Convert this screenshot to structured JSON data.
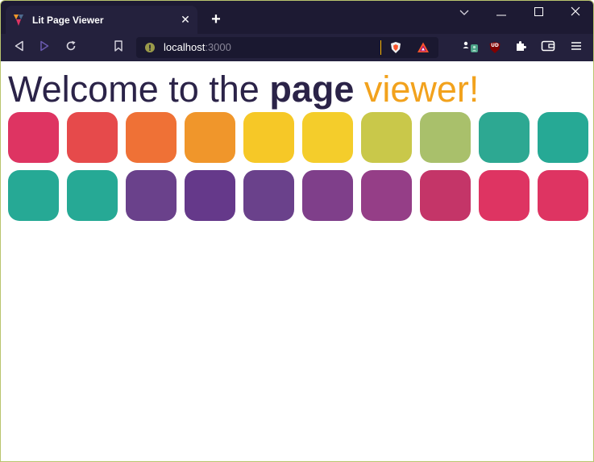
{
  "window": {
    "tab_title": "Lit Page Viewer",
    "close_tab_glyph": "✕",
    "new_tab_glyph": "+",
    "controls": [
      "chevron-down-icon",
      "minimize-icon",
      "maximize-icon",
      "close-icon"
    ]
  },
  "toolbar": {
    "url_host": "localhost",
    "url_port": ":3000",
    "icons": [
      "back-icon",
      "forward-icon",
      "reload-icon",
      "bookmark-icon",
      "site-info-icon",
      "brave-shields-icon",
      "brave-rewards-icon",
      "profile-icon",
      "ublock-icon",
      "extensions-icon",
      "wallet-icon",
      "menu-icon"
    ],
    "ublock_label": "UD"
  },
  "page": {
    "heading_part1": "Welcome to the ",
    "heading_bold": "page",
    "heading_space": " ",
    "heading_accent": "viewer!",
    "tiles": [
      {
        "color": "#de3462"
      },
      {
        "color": "#e64a4b"
      },
      {
        "color": "#ef7136"
      },
      {
        "color": "#f0962b"
      },
      {
        "color": "#f6c827"
      },
      {
        "color": "#f4cd2b"
      },
      {
        "color": "#c9c84a"
      },
      {
        "color": "#a9c06b"
      },
      {
        "color": "#2da892"
      },
      {
        "color": "#26a995"
      },
      {
        "color": "#26a995"
      },
      {
        "color": "#26a995"
      },
      {
        "color": "#6a418b"
      },
      {
        "color": "#65398a"
      },
      {
        "color": "#6a418b"
      },
      {
        "color": "#7f3f8a"
      },
      {
        "color": "#953e87"
      },
      {
        "color": "#c43568"
      },
      {
        "color": "#de3462"
      },
      {
        "color": "#de3462"
      }
    ]
  }
}
